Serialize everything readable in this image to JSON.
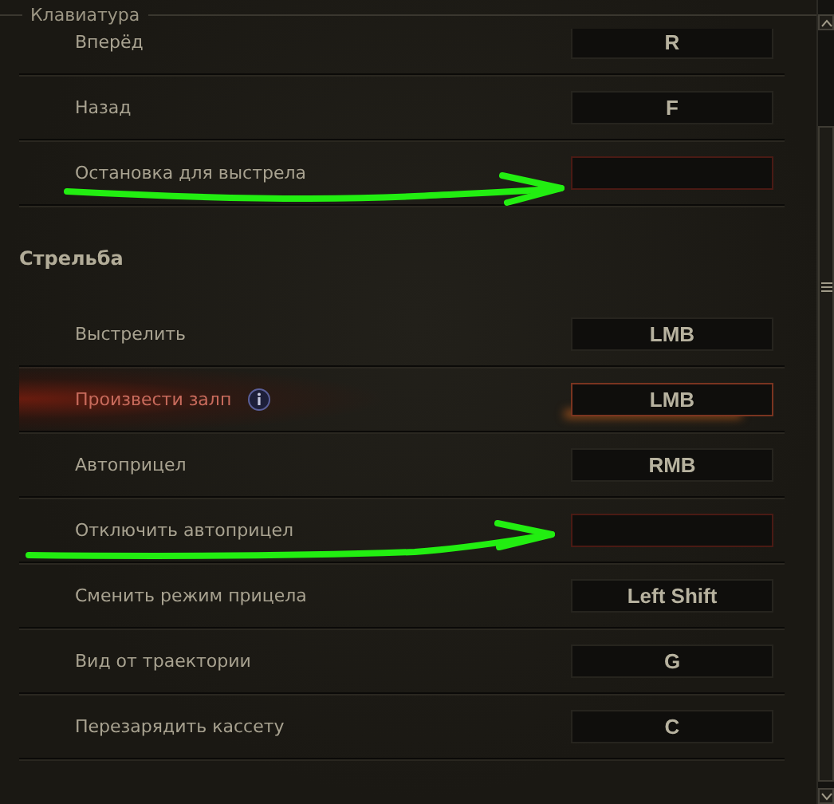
{
  "group": {
    "legend": "Клавиатура"
  },
  "sections": [
    {
      "rows": [
        {
          "label": "Вперёд",
          "key": "R",
          "unbound": false,
          "highlighted": false,
          "info": false,
          "arrow": false
        },
        {
          "label": "Назад",
          "key": "F",
          "unbound": false,
          "highlighted": false,
          "info": false,
          "arrow": false
        },
        {
          "label": "Остановка для выстрела",
          "unbound": true,
          "highlighted": false,
          "info": false,
          "arrow": true
        }
      ]
    },
    {
      "title": "Стрельба",
      "rows": [
        {
          "label": "Выстрелить",
          "key": "LMB",
          "unbound": false,
          "highlighted": false,
          "info": false,
          "arrow": false
        },
        {
          "label": "Произвести залп",
          "key": "LMB",
          "unbound": false,
          "highlighted": true,
          "info": true,
          "arrow": false
        },
        {
          "label": "Автоприцел",
          "key": "RMB",
          "unbound": false,
          "highlighted": false,
          "info": false,
          "arrow": false
        },
        {
          "label": "Отключить автоприцел",
          "unbound": true,
          "highlighted": false,
          "info": false,
          "arrow": true
        },
        {
          "label": "Сменить режим прицела",
          "key": "Left Shift",
          "unbound": false,
          "highlighted": false,
          "info": false,
          "arrow": false
        },
        {
          "label": "Вид от траектории",
          "key": "G",
          "unbound": false,
          "highlighted": false,
          "info": false,
          "arrow": false
        },
        {
          "label": "Перезарядить кассету",
          "key": "C",
          "unbound": false,
          "highlighted": false,
          "info": false,
          "arrow": false
        }
      ]
    }
  ]
}
